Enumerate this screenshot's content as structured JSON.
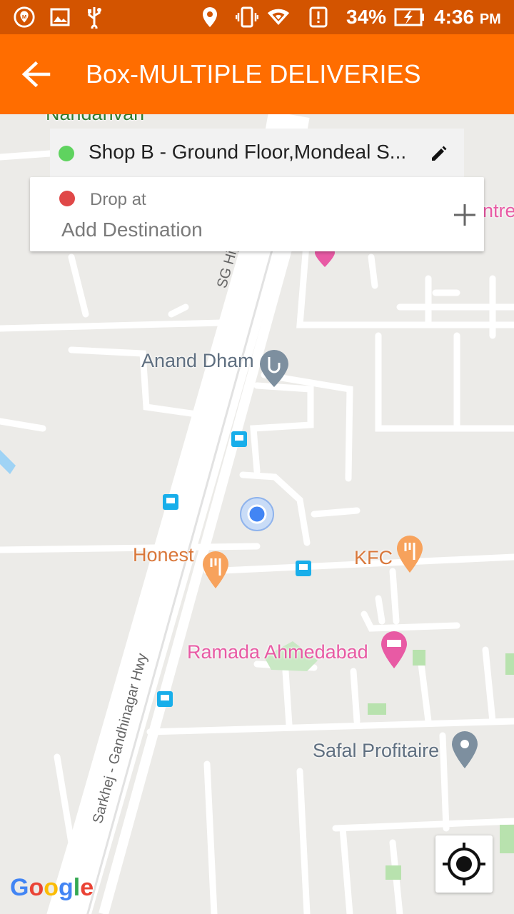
{
  "status_bar": {
    "battery": "34%",
    "time": "4:36",
    "ampm": "PM",
    "icons": [
      "maps-notification-icon",
      "gallery-icon",
      "usb-icon",
      "location-icon",
      "vibrate-icon",
      "wifi-icon",
      "alert-icon",
      "battery-charging-icon"
    ]
  },
  "app_bar": {
    "title": "Box-MULTIPLE DELIVERIES",
    "back_icon": "arrow-back-icon",
    "color": "#ff6d00"
  },
  "pickup": {
    "address": "Shop B - Ground Floor,Mondeal S...",
    "dot_color": "#5fd35f",
    "edit_icon": "pencil-icon"
  },
  "drop": {
    "label": "Drop at",
    "placeholder": "Add Destination",
    "dot_color": "#e04848",
    "add_icon": "plus-icon"
  },
  "map": {
    "labels": {
      "nandanvan": "Nandanvan",
      "centre_partial": "ntre",
      "sg_highway": "SG Highwa",
      "anand_dham": "Anand Dham",
      "honest": "Honest",
      "kfc": "KFC",
      "ramada": "Ramada Ahmedabad",
      "safal": "Safal Profitaire",
      "sarkhej": "Sarkhej - Gandhinagar Hwy"
    },
    "google": [
      "G",
      "o",
      "o",
      "g",
      "l",
      "e"
    ],
    "locate_icon": "my-location-icon"
  }
}
